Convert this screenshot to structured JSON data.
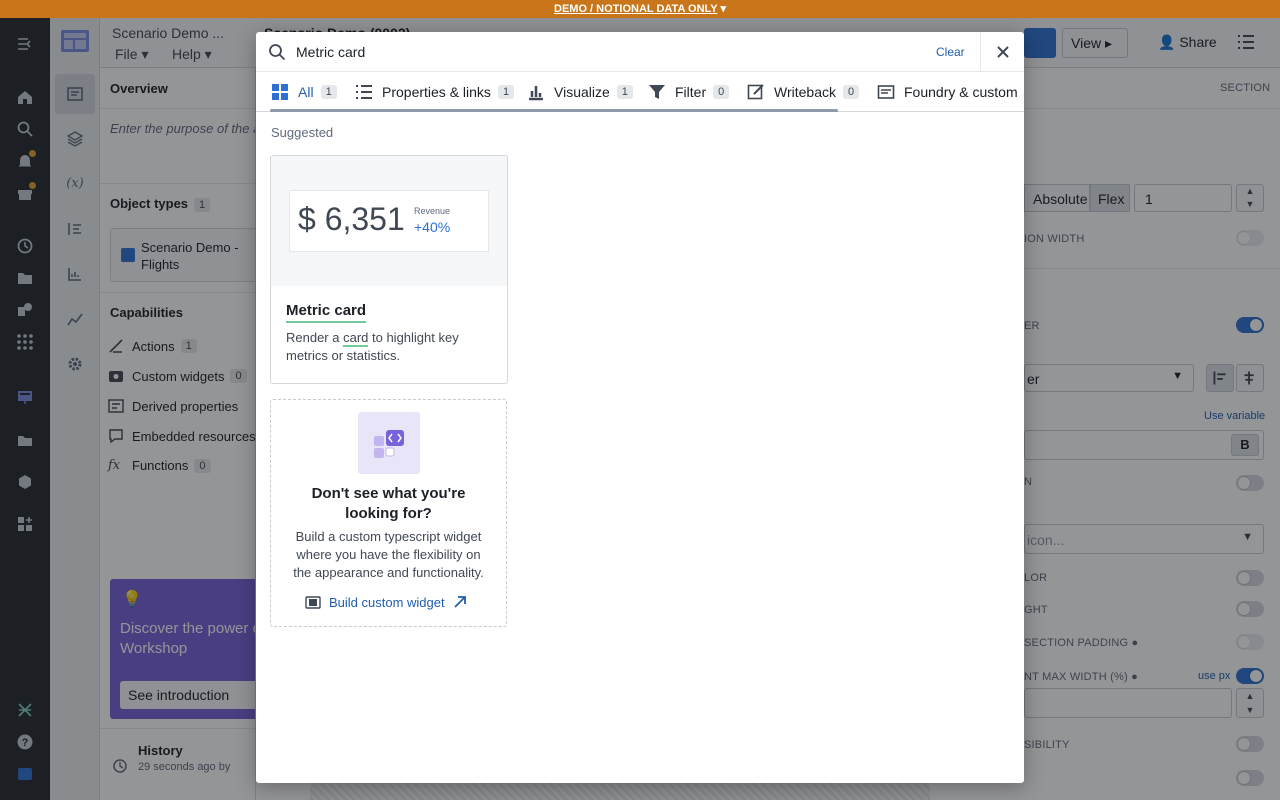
{
  "banner": {
    "text": "DEMO / NOTIONAL DATA ONLY",
    "caret": "▾"
  },
  "app": {
    "breadcrumb": "Scenario Demo ...",
    "title": "Scenario Demo (0002)",
    "menu_file": "File",
    "menu_help": "Help",
    "view_label": "View",
    "share_label": "Share"
  },
  "left_panel": {
    "overview_title": "Overview",
    "purpose_placeholder": "Enter the purpose of the a",
    "object_types_title": "Object types",
    "object_types_count": "1",
    "object_type_name_1": "Scenario Demo -",
    "object_type_name_2": "Flights",
    "capabilities_title": "Capabilities",
    "capabilities": [
      {
        "label": "Actions",
        "count": "1"
      },
      {
        "label": "Custom widgets",
        "count": "0"
      },
      {
        "label": "Derived properties",
        "count": ""
      },
      {
        "label": "Embedded resources",
        "count": ""
      },
      {
        "label": "Functions",
        "count": "0"
      }
    ],
    "promo_line1": "Discover the power o",
    "promo_line2": "Workshop",
    "promo_button": "See introduction",
    "history_title": "History",
    "history_time": "29 seconds ago by"
  },
  "right_panel": {
    "section_label": "SECTION",
    "absolute_label": "Absolute",
    "flex_label": "Flex",
    "flex_value": "1",
    "width_label": "ION WIDTH",
    "header_label": "ER",
    "dropdown_value": "er",
    "use_variable": "Use variable",
    "bold_label": "B",
    "icon_toggle_label": "N",
    "icon_placeholder": "icon...",
    "color_label": "LOR",
    "height_label": "GHT",
    "padding_label": "SECTION PADDING",
    "max_width_label": "NT MAX WIDTH (%)",
    "use_px": "use px",
    "visibility_label": "SIBILITY"
  },
  "modal": {
    "search_value": "Metric card",
    "clear_label": "Clear",
    "tabs": [
      {
        "label": "All",
        "count": "1"
      },
      {
        "label": "Properties & links",
        "count": "1"
      },
      {
        "label": "Visualize",
        "count": "1"
      },
      {
        "label": "Filter",
        "count": "0"
      },
      {
        "label": "Writeback",
        "count": "0"
      },
      {
        "label": "Foundry & custom",
        "count": ""
      }
    ],
    "suggested_label": "Suggested",
    "metric_card": {
      "preview_value": "$ 6,351",
      "preview_label": "Revenue",
      "preview_change": "+40%",
      "title": "Metric card",
      "desc_before": "Render a ",
      "desc_keyword": "card",
      "desc_after": " to highlight key metrics or statistics."
    },
    "custom_card": {
      "title_line1": "Don't see what you're",
      "title_line2": "looking for?",
      "description": "Build a custom typescript widget where you have the flexibility on the appearance and functionality.",
      "link_label": "Build custom widget"
    }
  },
  "colors": {
    "banner": "#c87619",
    "accent": "#2d72d2",
    "link": "#215db0",
    "rail": "#252a31",
    "promo": "#7961db"
  }
}
